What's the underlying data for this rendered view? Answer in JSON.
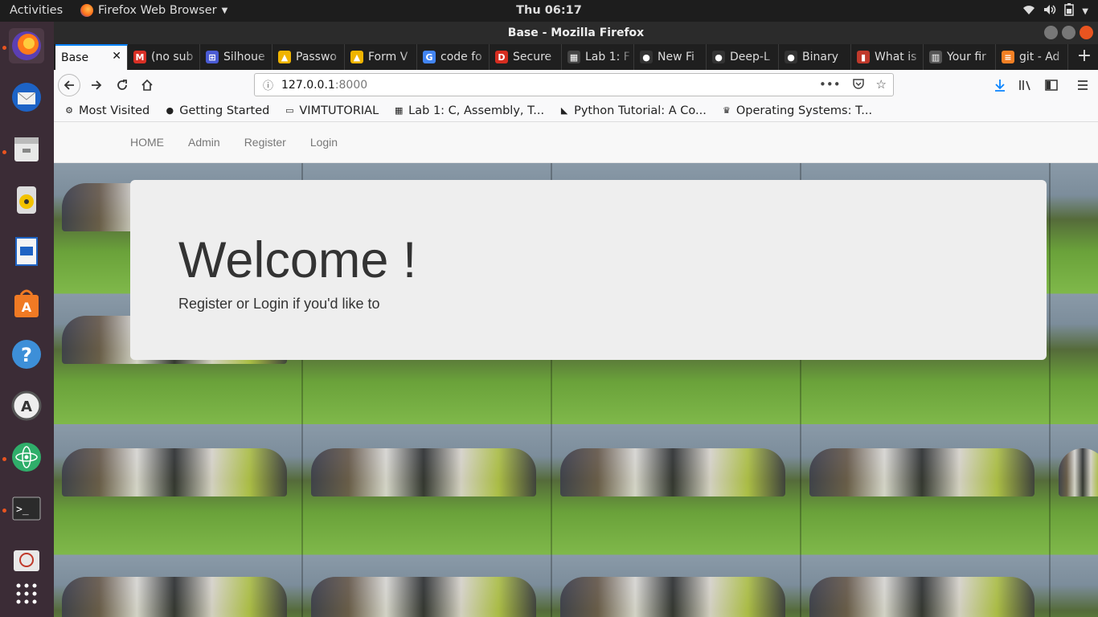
{
  "topbar": {
    "activities": "Activities",
    "app_name": "Firefox Web Browser",
    "clock": "Thu 06:17"
  },
  "dock": {
    "items": [
      "firefox-icon",
      "thunderbird-icon",
      "files-icon",
      "rhythmbox-icon",
      "writer-icon",
      "software-icon",
      "help-icon",
      "updater-icon",
      "atom-icon",
      "terminal-icon",
      "remote-icon",
      "app-grid-icon"
    ]
  },
  "window": {
    "title": "Base - Mozilla Firefox"
  },
  "tabs": [
    {
      "label": "Base",
      "icon": "",
      "color": "#f9f9fa"
    },
    {
      "label": "(no sub",
      "icon": "M",
      "color": "#d93025"
    },
    {
      "label": "Silhoue",
      "icon": "⊞",
      "color": "#4a5bd4"
    },
    {
      "label": "Passwo",
      "icon": "▲",
      "color": "#f0b400"
    },
    {
      "label": "Form V",
      "icon": "▲",
      "color": "#f0b400"
    },
    {
      "label": "code fo",
      "icon": "G",
      "color": "#4285f4"
    },
    {
      "label": "Secure",
      "icon": "D",
      "color": "#d62d20"
    },
    {
      "label": "Lab 1: F",
      "icon": "▦",
      "color": "#444444"
    },
    {
      "label": "New Fi",
      "icon": "●",
      "color": "#333333"
    },
    {
      "label": "Deep-L",
      "icon": "●",
      "color": "#333333"
    },
    {
      "label": "Binary",
      "icon": "●",
      "color": "#333333"
    },
    {
      "label": "What is",
      "icon": "▮",
      "color": "#c0392b"
    },
    {
      "label": "Your fir",
      "icon": "▥",
      "color": "#555555"
    },
    {
      "label": "git - Ad",
      "icon": "≡",
      "color": "#f48024"
    }
  ],
  "navbar": {
    "url_host": "127.0.0.1",
    "url_port": ":8000"
  },
  "bookmarks": [
    {
      "label": "Most Visited",
      "icon": "⚙"
    },
    {
      "label": "Getting Started",
      "icon": "●"
    },
    {
      "label": "VIMTUTORIAL",
      "icon": "▭"
    },
    {
      "label": "Lab 1: C, Assembly, T...",
      "icon": "▦"
    },
    {
      "label": "Python Tutorial: A Co...",
      "icon": "◣"
    },
    {
      "label": "Operating Systems: T...",
      "icon": "♛"
    }
  ],
  "site": {
    "nav": [
      "HOME",
      "Admin",
      "Register",
      "Login"
    ],
    "heading": "Welcome !",
    "subtext": "Register or Login if you'd like to"
  }
}
